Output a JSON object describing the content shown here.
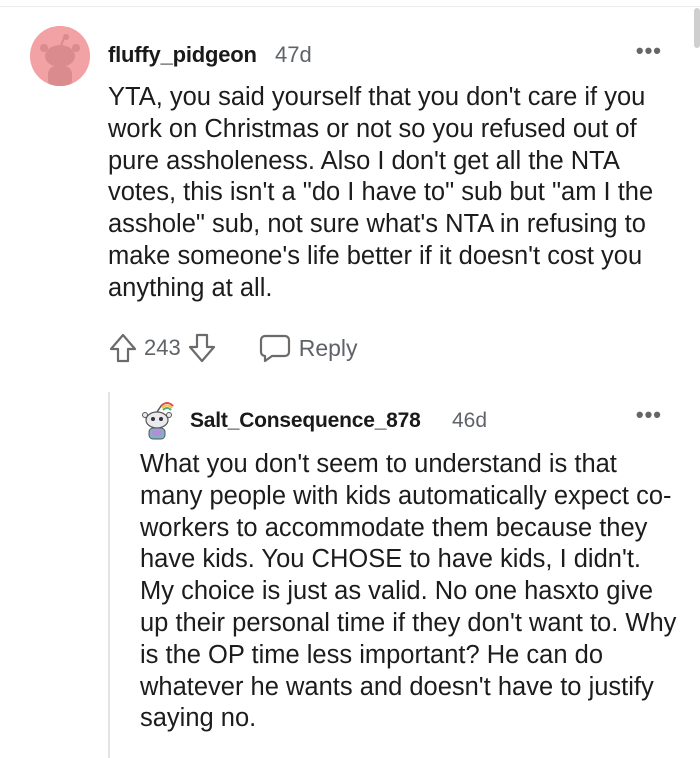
{
  "comment": {
    "author": "fluffy_pidgeon",
    "age": "47d",
    "more_label": "•••",
    "avatar_icon": "snoo-avatar-icon",
    "avatar_color": "#f2a1a4",
    "body": "YTA, you said yourself that you don't care if you work on Christmas or not so you refused out of pure assholeness. Also I don't get all the NTA votes, this isn't a \"do I have to\" sub but \"am I the asshole\" sub, not sure what's NTA in refusing to make someone's life better if it doesn't cost you anything at all.",
    "score": "243",
    "upvote_icon": "upvote-arrow-icon",
    "downvote_icon": "downvote-arrow-icon",
    "reply_icon": "speech-bubble-icon",
    "reply_label": "Reply"
  },
  "reply": {
    "author": "Salt_Consequence_878",
    "age": "46d",
    "more_label": "•••",
    "avatar_icon": "snoo-avatar-icon",
    "body": "What you don't seem to understand is that many people with kids automatically expect co-workers to accommodate them because they have kids. You CHOSE to have kids, I didn't. My choice is just as valid. No one hasxto give up their personal time if they don't want to. Why is the OP time less important? He can do whatever he wants and doesn't have to justify saying no."
  }
}
